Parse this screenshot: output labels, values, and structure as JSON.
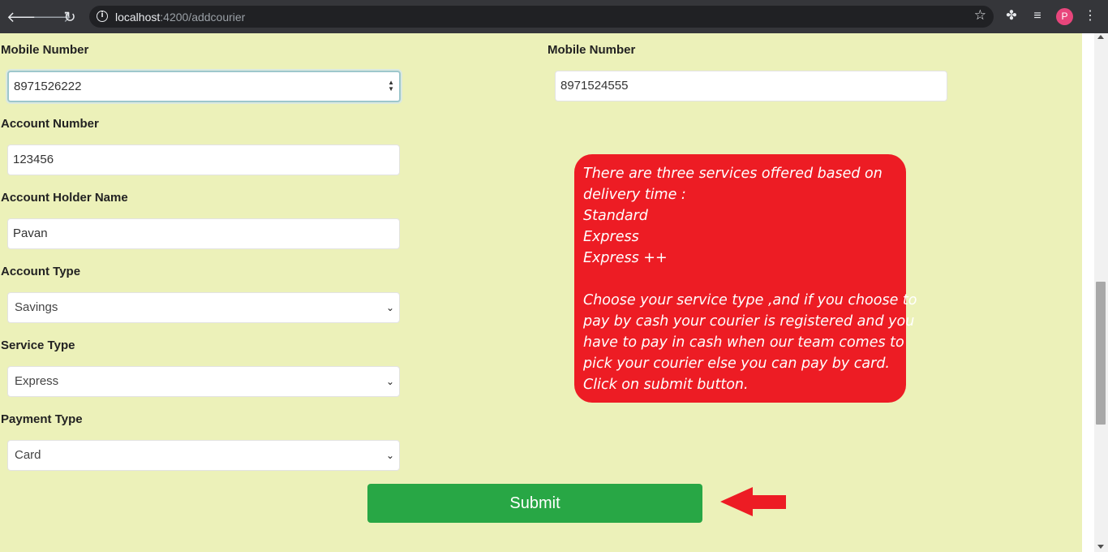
{
  "browser": {
    "url_host": "localhost",
    "url_rest": ":4200/addcourier",
    "profile_initial": "P"
  },
  "form": {
    "sender_mobile": {
      "label": "Mobile Number",
      "value": "8971526222"
    },
    "receiver_mobile": {
      "label": "Mobile Number",
      "value": "8971524555"
    },
    "account_number": {
      "label": "Account Number",
      "value": "123456"
    },
    "account_holder": {
      "label": "Account Holder Name",
      "value": "Pavan"
    },
    "account_type": {
      "label": "Account Type",
      "selected": "Savings"
    },
    "service_type": {
      "label": "Service Type",
      "selected": "Express"
    },
    "payment_type": {
      "label": "Payment Type",
      "selected": "Card"
    },
    "submit_label": "Submit"
  },
  "info": {
    "lines": [
      "There are three services offered based on",
      "delivery time :",
      "Standard",
      "Express",
      "Express ++",
      "",
      "Choose your service type ,and if you choose to",
      "pay by cash your courier is registered and you",
      "have to pay in cash when our team comes to",
      "pick your courier else you can pay by card.",
      "Click on submit button."
    ]
  },
  "colors": {
    "page_bg": "#ecf1b9",
    "info_bg": "#ed1c24",
    "submit_bg": "#28a745",
    "arrow": "#ed1c24"
  },
  "icons": [
    "back-icon",
    "forward-icon",
    "reload-icon",
    "info-icon",
    "star-icon",
    "extensions-icon",
    "media-icon",
    "menu-icon",
    "chevron-down-icon",
    "arrow-left-icon"
  ]
}
